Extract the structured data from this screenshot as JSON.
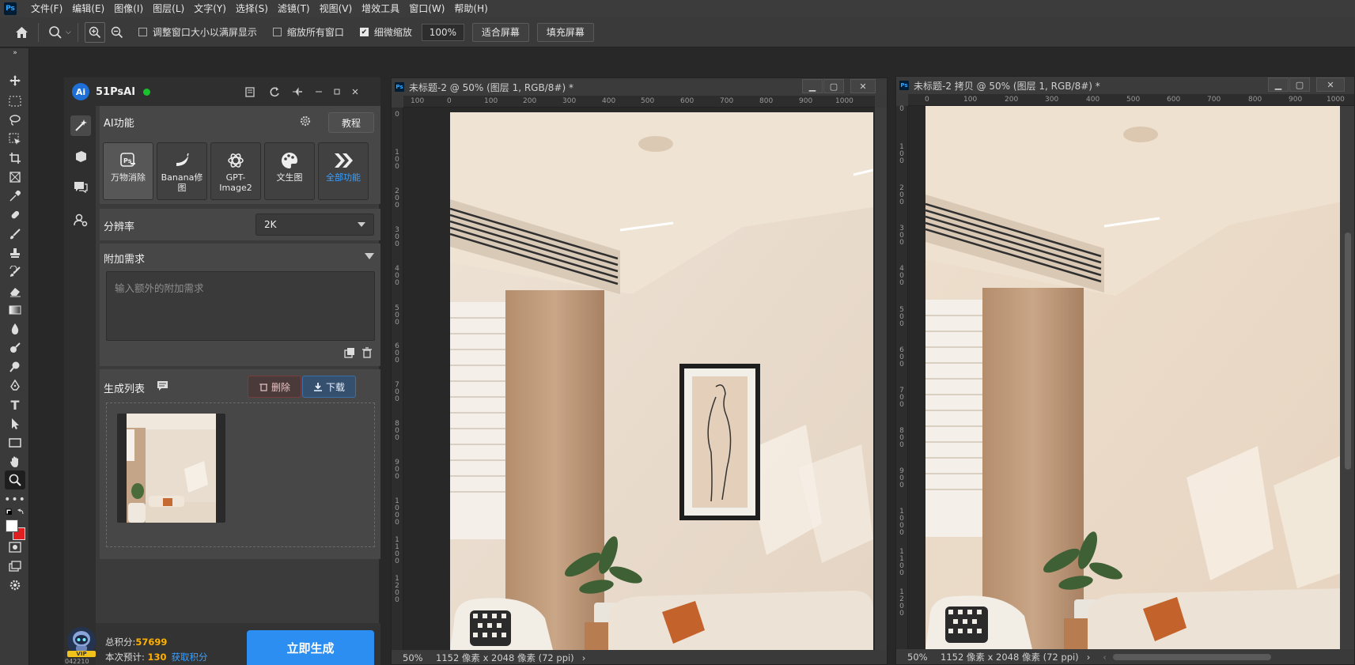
{
  "menubar": {
    "app_logo": "Ps",
    "items": [
      "文件(F)",
      "编辑(E)",
      "图像(I)",
      "图层(L)",
      "文字(Y)",
      "选择(S)",
      "滤镜(T)",
      "视图(V)",
      "增效工具",
      "窗口(W)",
      "帮助(H)"
    ]
  },
  "options": {
    "resize_windows_label": "调整窗口大小以满屏显示",
    "zoom_all_label": "缩放所有窗口",
    "scrubby_zoom_label": "细微缩放",
    "zoom_value": "100%",
    "fit_screen": "适合屏幕",
    "fill_screen": "填充屏幕"
  },
  "plugin": {
    "name": "51PsAI",
    "logo": "Ai",
    "ai_section_title": "AI功能",
    "tutorial_button": "教程",
    "features": [
      {
        "label": "万物消除",
        "icon": "ps-erase-icon"
      },
      {
        "label": "Banana修\n图",
        "icon": "banana-icon"
      },
      {
        "label": "GPT-\nImage2",
        "icon": "openai-icon"
      },
      {
        "label": "文生图",
        "icon": "palette-icon"
      },
      {
        "label": "全部功能",
        "icon": "double-chevron-icon"
      }
    ],
    "resolution_label": "分辨率",
    "resolution_value": "2K",
    "extra_label": "附加需求",
    "extra_placeholder": "输入额外的附加需求",
    "gen_list_label": "生成列表",
    "delete_button": "删除",
    "download_button": "下载",
    "points_label": "总积分:",
    "points_value": "57699",
    "estimate_label": "本次预计:",
    "estimate_value": "130",
    "get_points_link": "获取积分",
    "generate_button": "立即生成",
    "avatar_badge": "VIP",
    "user_id_partial": "042210"
  },
  "docs": [
    {
      "title": "未标题-2 @ 50% (图层 1, RGB/8#) *",
      "zoom": "50%",
      "info": "1152 像素 x 2048 像素 (72 ppi)",
      "ruler_h": [
        "100",
        "0",
        "100",
        "200",
        "300",
        "400",
        "500",
        "600",
        "700",
        "800",
        "900",
        "1000"
      ],
      "ruler_v": [
        "0",
        "100",
        "200",
        "300",
        "400",
        "500",
        "600",
        "700",
        "800",
        "900",
        "1000",
        "1100",
        "1200"
      ]
    },
    {
      "title": "未标题-2 拷贝 @ 50% (图层 1, RGB/8#) *",
      "zoom": "50%",
      "info": "1152 像素 x 2048 像素 (72 ppi)",
      "ruler_h": [
        "0",
        "100",
        "200",
        "300",
        "400",
        "500",
        "600",
        "700",
        "800",
        "900",
        "1000"
      ],
      "ruler_v": [
        "0",
        "100",
        "200",
        "300",
        "400",
        "500",
        "600",
        "700",
        "800",
        "900",
        "1000",
        "1100",
        "1200"
      ]
    }
  ]
}
